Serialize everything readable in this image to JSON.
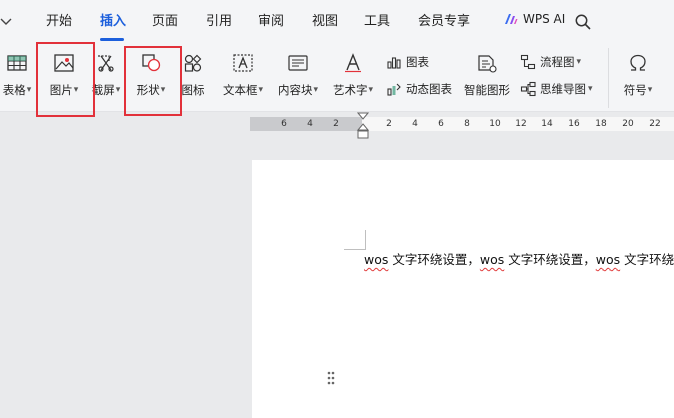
{
  "menu": {
    "tabs": [
      {
        "label": "开始"
      },
      {
        "label": "插入",
        "active": true
      },
      {
        "label": "页面"
      },
      {
        "label": "引用"
      },
      {
        "label": "审阅"
      },
      {
        "label": "视图"
      },
      {
        "label": "工具"
      },
      {
        "label": "会员专享"
      }
    ],
    "wps_ai_label": "WPS AI"
  },
  "ribbon": {
    "table_label": "表格",
    "picture_label": "图片",
    "screenshot_label": "截屏",
    "shape_label": "形状",
    "icon_label": "图标",
    "textbox_label": "文本框",
    "content_block_label": "内容块",
    "wordart_label": "艺术字",
    "chart_label": "图表",
    "dynamic_chart_label": "动态图表",
    "smart_graphic_label": "智能图形",
    "flowchart_label": "流程图",
    "mindmap_label": "思维导图",
    "symbol_label": "符号",
    "dropdown_glyph": "▾"
  },
  "ruler": {
    "numbers": [
      "6",
      "4",
      "2",
      "2",
      "4",
      "6",
      "8",
      "10",
      "12",
      "14",
      "16",
      "18",
      "20",
      "22"
    ]
  },
  "document": {
    "line_parts": [
      {
        "text": "wos",
        "flag": true
      },
      {
        "text": " 文字环绕设置，",
        "flag": false
      },
      {
        "text": "wos",
        "flag": true
      },
      {
        "text": " 文字环绕设置，",
        "flag": false
      },
      {
        "text": "wos",
        "flag": true
      },
      {
        "text": " 文字环绕",
        "flag": false
      }
    ]
  },
  "colors": {
    "accent": "#1c5fdc",
    "highlight": "#e2313a",
    "spellcheck": "#e03a3a"
  }
}
